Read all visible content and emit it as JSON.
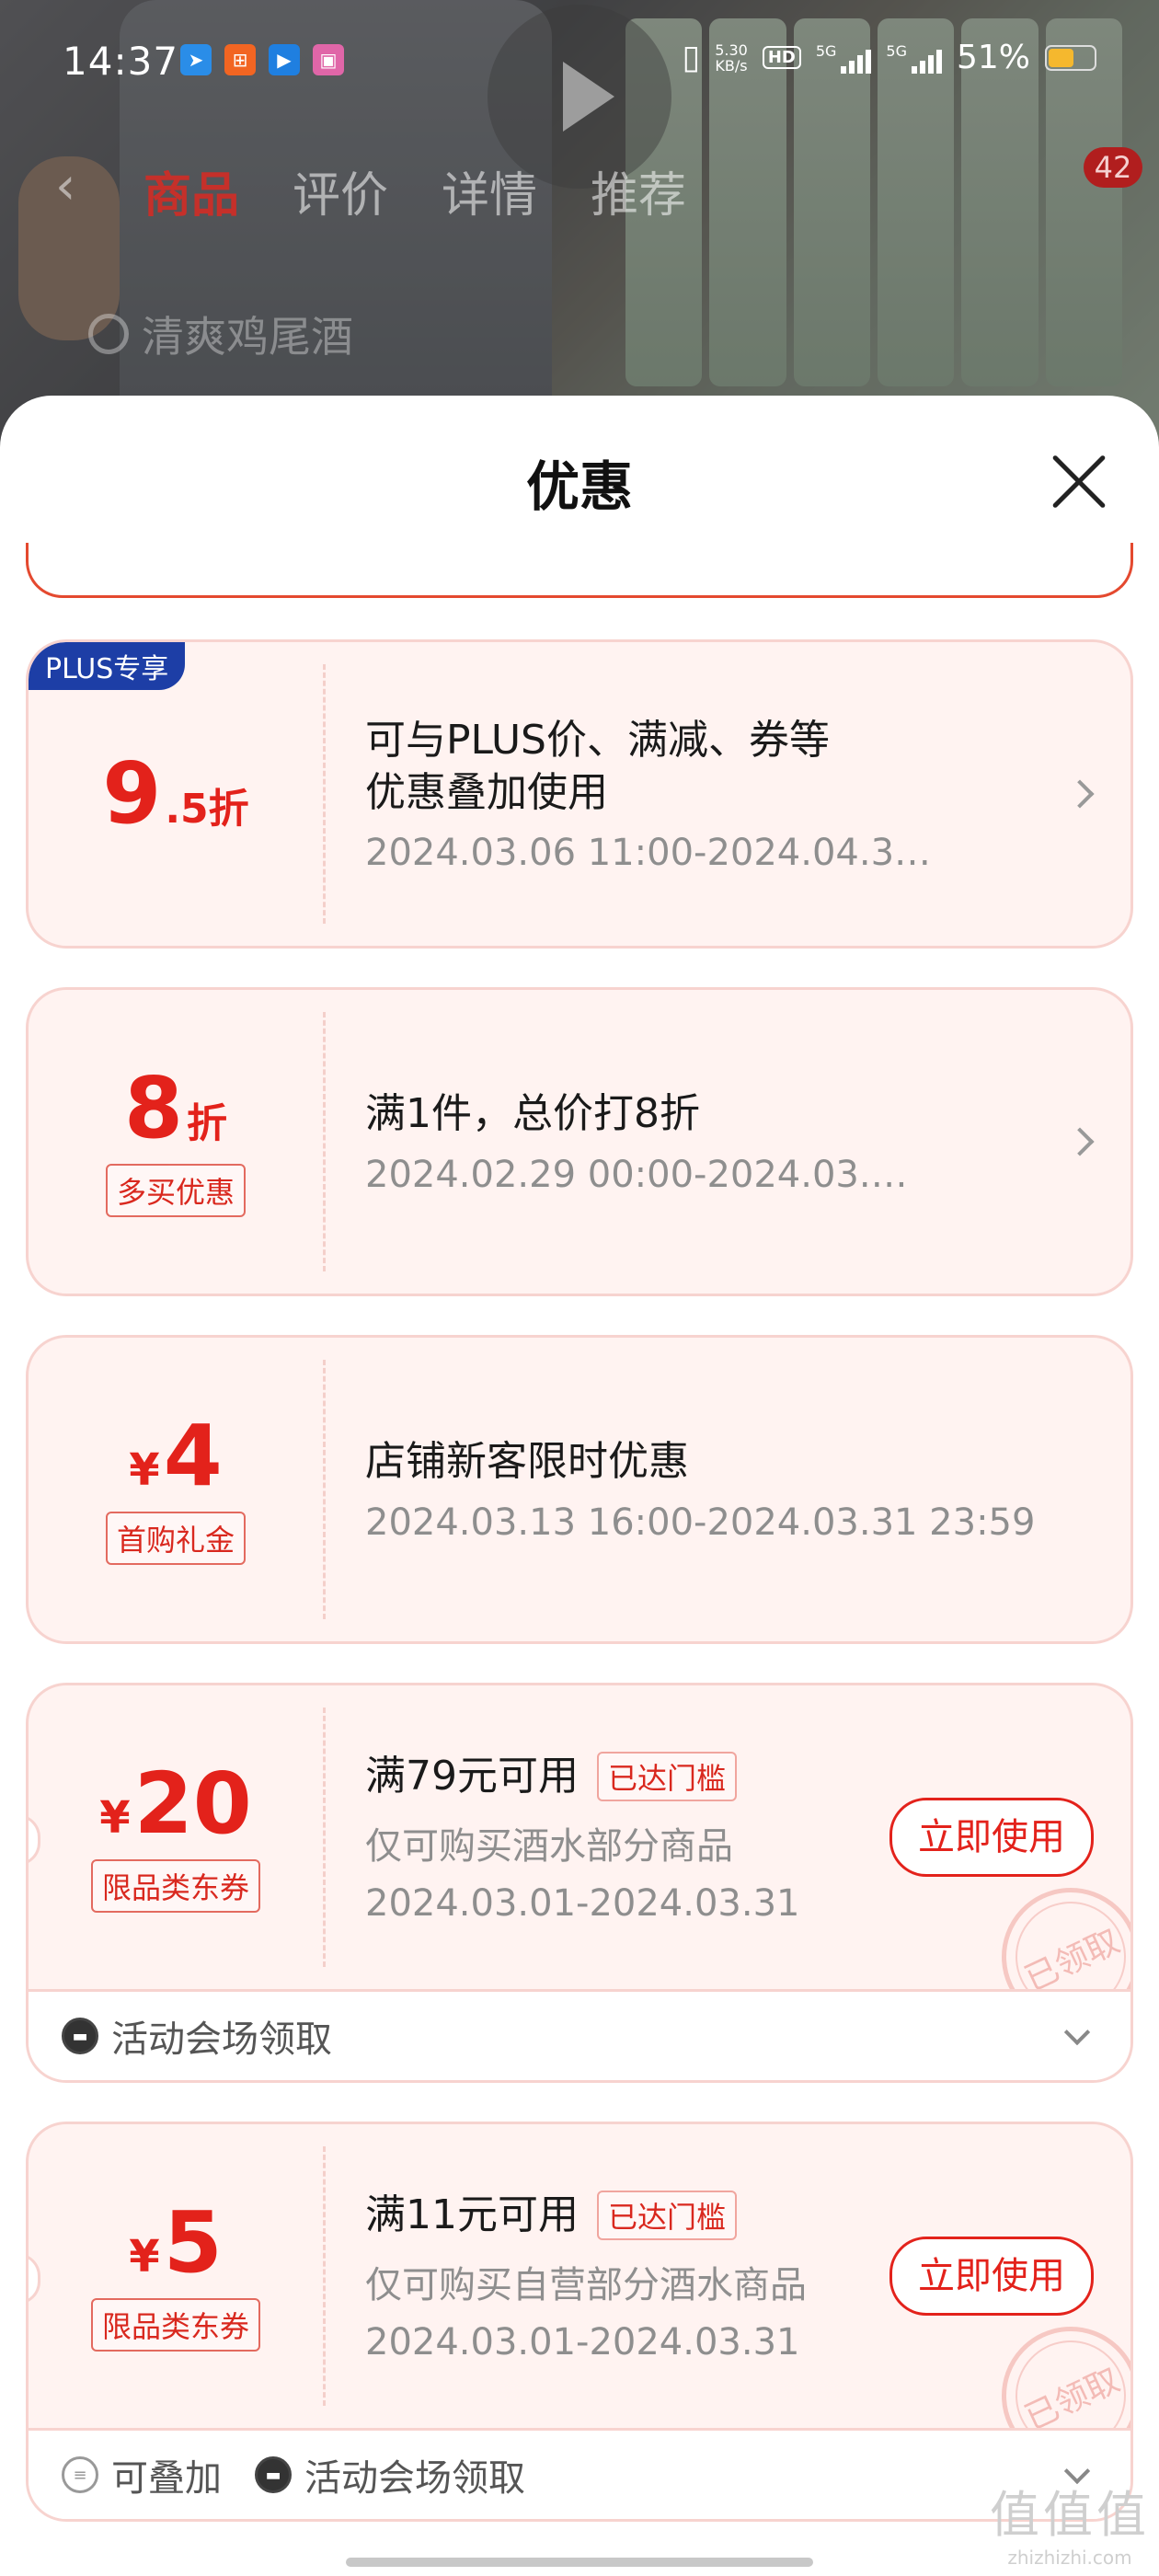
{
  "status_bar": {
    "time": "14:37",
    "net_speed_value": "5.30",
    "net_speed_unit": "KB/s",
    "hd_label": "HD",
    "sim1_label": "5G",
    "sim2_label": "5G",
    "battery_text": "51%",
    "battery_level": 0.51
  },
  "product_nav": {
    "tabs": [
      "商品",
      "评价",
      "详情",
      "推荐"
    ],
    "active_tab": "商品",
    "cart_count": "42",
    "search_text": "清爽鸡尾酒"
  },
  "sheet": {
    "title": "优惠"
  },
  "coupons": [
    {
      "badge": "PLUS专享",
      "value": "9",
      "value_suffix": ".5折",
      "line1": "可与PLUS价、满减、券等",
      "line2": "优惠叠加使用",
      "time": "2024.03.06 11:00-2024.04.3…"
    },
    {
      "value": "8",
      "value_suffix": "折",
      "tag": "多买优惠",
      "title": "满1件，总价打8折",
      "time": "2024.02.29 00:00-2024.03.…"
    },
    {
      "currency": "¥",
      "value": "4",
      "tag": "首购礼金",
      "title": "店铺新客限时优惠",
      "time": "2024.03.13 16:00-2024.03.31 23:59"
    },
    {
      "currency": "¥",
      "value": "20",
      "tag": "限品类东券",
      "title": "满79元可用",
      "threshold_tag": "已达门槛",
      "scope": "仅可购买酒水部分商品",
      "time": "2024.03.01-2024.03.31",
      "button": "立即使用",
      "stamp": "已领取",
      "footer": [
        "活动会场领取"
      ]
    },
    {
      "currency": "¥",
      "value": "5",
      "tag": "限品类东券",
      "title": "满11元可用",
      "threshold_tag": "已达门槛",
      "scope": "仅可购买自营部分酒水商品",
      "time": "2024.03.01-2024.03.31",
      "button": "立即使用",
      "stamp": "已领取",
      "footer": [
        "可叠加",
        "活动会场领取"
      ]
    }
  ],
  "watermark": {
    "logo": "值值值",
    "url": "zhizhizhi.com"
  },
  "colors": {
    "accent_red": "#e3221b",
    "plus_blue": "#1d3ea6",
    "coupon_bg": "#fff3f1"
  }
}
